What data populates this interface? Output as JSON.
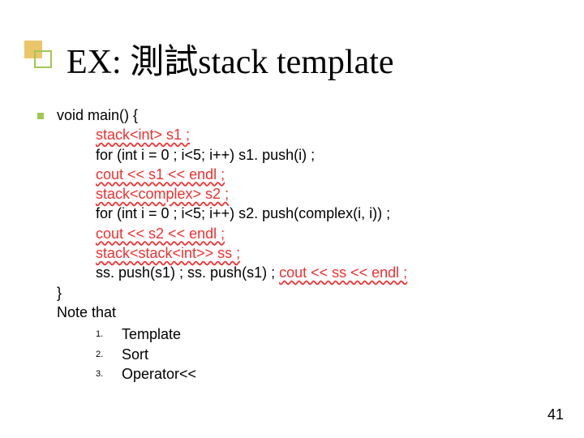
{
  "title": "EX: 測試stack template",
  "code": {
    "l1": "void main() {",
    "l2": "stack<int> s1 ;",
    "l3": "for (int i = 0 ; i<5; i++) s1. push(i) ;",
    "l4": "cout << s1 << endl ;",
    "l5": "stack<complex> s2 ;",
    "l6": "for (int i = 0 ; i<5; i++) s2. push(complex(i, i)) ;",
    "l7": "cout << s2 << endl ;",
    "l8": "stack<stack<int>> ss ;",
    "l9a": "ss. push(s1) ; ss. push(s1) ; ",
    "l9b": "cout << ss << endl ;",
    "l10": "}",
    "l11": "Note that"
  },
  "notes": {
    "n1": "Template",
    "n2": "Sort",
    "n3": "Operator<<"
  },
  "page_number": "41"
}
